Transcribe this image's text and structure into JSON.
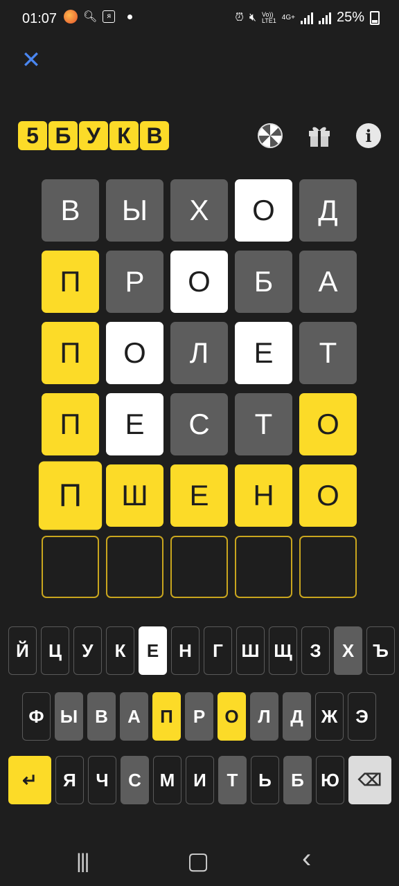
{
  "status": {
    "time": "01:07",
    "battery": "25%",
    "icons": [
      "fox-icon",
      "search-icon",
      "news-icon",
      "dot-icon",
      "alarm-icon",
      "mute-icon",
      "volte-icon",
      "4g-icon",
      "signal-icon",
      "signal-icon",
      "battery-icon"
    ],
    "net1": "Vo))\nLTE1",
    "net2": "4G+"
  },
  "header": {
    "close": "✕",
    "logo": [
      "5",
      "Б",
      "У",
      "К",
      "В"
    ],
    "info_glyph": "i"
  },
  "colors": {
    "yellow": "#fcdb28",
    "gray": "#5d5d5d",
    "white": "#ffffff",
    "bg": "#1e1e1e",
    "close_blue": "#4a86f0"
  },
  "board": [
    [
      {
        "l": "В",
        "s": "gray"
      },
      {
        "l": "Ы",
        "s": "gray"
      },
      {
        "l": "Х",
        "s": "gray"
      },
      {
        "l": "О",
        "s": "white"
      },
      {
        "l": "Д",
        "s": "gray"
      }
    ],
    [
      {
        "l": "П",
        "s": "yellow"
      },
      {
        "l": "Р",
        "s": "gray"
      },
      {
        "l": "О",
        "s": "white"
      },
      {
        "l": "Б",
        "s": "gray"
      },
      {
        "l": "А",
        "s": "gray"
      }
    ],
    [
      {
        "l": "П",
        "s": "yellow"
      },
      {
        "l": "О",
        "s": "white"
      },
      {
        "l": "Л",
        "s": "gray"
      },
      {
        "l": "Е",
        "s": "white"
      },
      {
        "l": "Т",
        "s": "gray"
      }
    ],
    [
      {
        "l": "П",
        "s": "yellow"
      },
      {
        "l": "Е",
        "s": "white"
      },
      {
        "l": "С",
        "s": "gray"
      },
      {
        "l": "Т",
        "s": "gray"
      },
      {
        "l": "О",
        "s": "yellow"
      }
    ],
    [
      {
        "l": "П",
        "s": "yellow"
      },
      {
        "l": "Ш",
        "s": "yellow"
      },
      {
        "l": "Е",
        "s": "yellow"
      },
      {
        "l": "Н",
        "s": "yellow"
      },
      {
        "l": "О",
        "s": "yellow"
      }
    ],
    [
      {
        "l": "",
        "s": "empty"
      },
      {
        "l": "",
        "s": "empty"
      },
      {
        "l": "",
        "s": "empty"
      },
      {
        "l": "",
        "s": "empty"
      },
      {
        "l": "",
        "s": "empty"
      }
    ]
  ],
  "keyboard": {
    "row1": [
      {
        "k": "Й",
        "s": ""
      },
      {
        "k": "Ц",
        "s": ""
      },
      {
        "k": "У",
        "s": ""
      },
      {
        "k": "К",
        "s": ""
      },
      {
        "k": "Е",
        "s": "white"
      },
      {
        "k": "Н",
        "s": ""
      },
      {
        "k": "Г",
        "s": ""
      },
      {
        "k": "Ш",
        "s": ""
      },
      {
        "k": "Щ",
        "s": ""
      },
      {
        "k": "З",
        "s": ""
      },
      {
        "k": "Х",
        "s": "gray"
      },
      {
        "k": "Ъ",
        "s": ""
      }
    ],
    "row2": [
      {
        "k": "Ф",
        "s": ""
      },
      {
        "k": "Ы",
        "s": "gray"
      },
      {
        "k": "В",
        "s": "gray"
      },
      {
        "k": "А",
        "s": "gray"
      },
      {
        "k": "П",
        "s": "yellow"
      },
      {
        "k": "Р",
        "s": "gray"
      },
      {
        "k": "О",
        "s": "yellow"
      },
      {
        "k": "Л",
        "s": "gray"
      },
      {
        "k": "Д",
        "s": "gray"
      },
      {
        "k": "Ж",
        "s": ""
      },
      {
        "k": "Э",
        "s": ""
      }
    ],
    "row3": [
      {
        "k": "Я",
        "s": ""
      },
      {
        "k": "Ч",
        "s": ""
      },
      {
        "k": "С",
        "s": "gray"
      },
      {
        "k": "М",
        "s": ""
      },
      {
        "k": "И",
        "s": ""
      },
      {
        "k": "Т",
        "s": "gray"
      },
      {
        "k": "Ь",
        "s": ""
      },
      {
        "k": "Б",
        "s": "gray"
      },
      {
        "k": "Ю",
        "s": ""
      }
    ],
    "enter_glyph": "↵",
    "backspace_glyph": "⌫"
  },
  "navbar": {
    "recent": "|||",
    "home": "▢",
    "back": "‹"
  }
}
